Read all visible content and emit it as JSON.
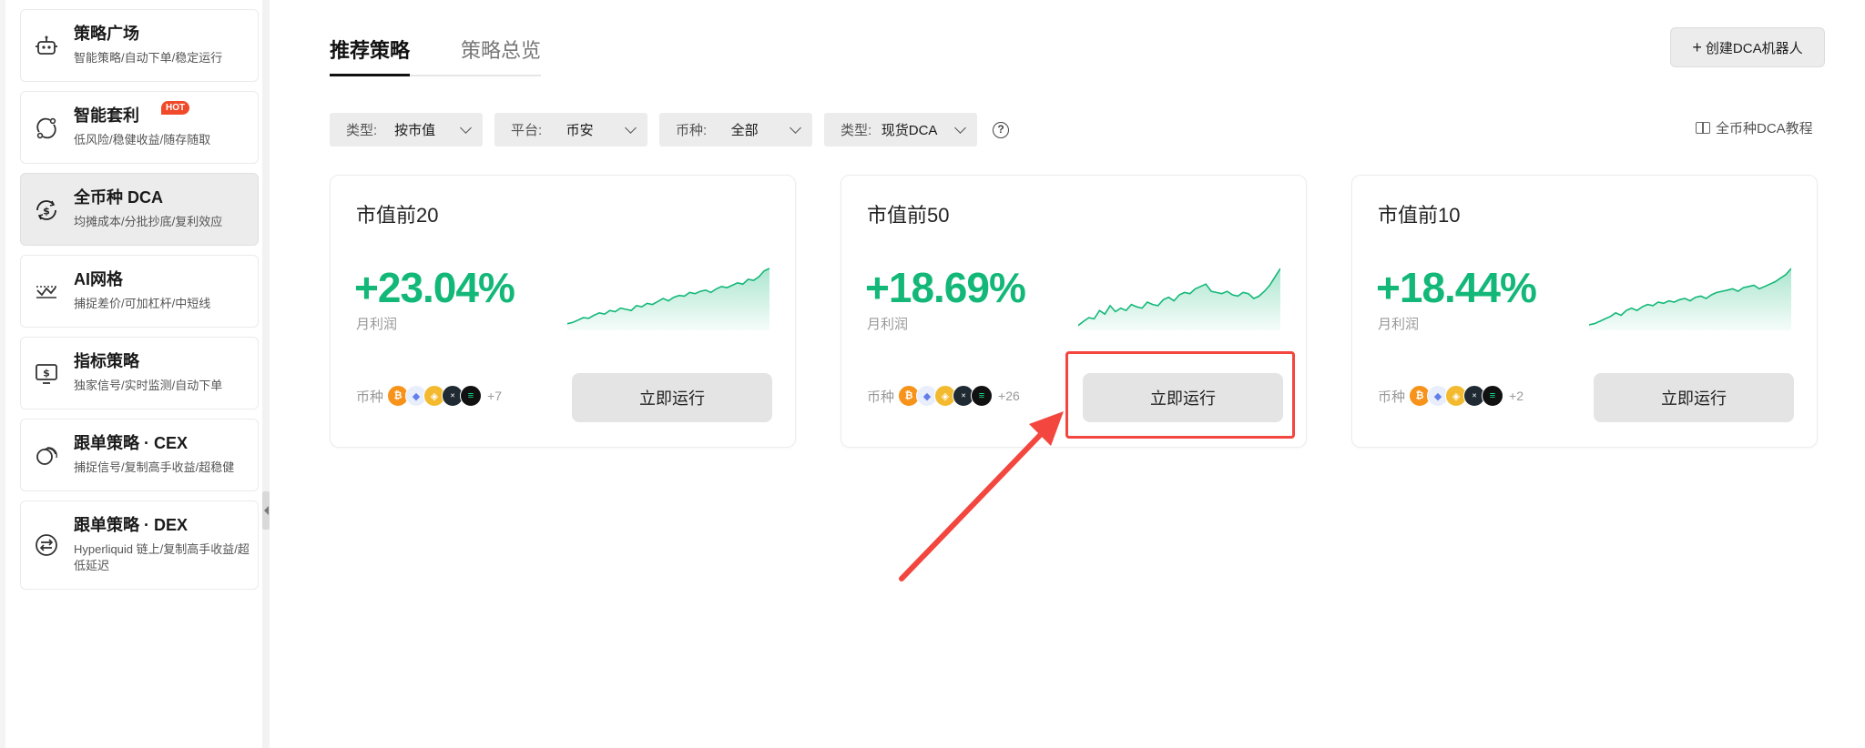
{
  "sidebar": {
    "items": [
      {
        "title": "策略广场",
        "subtitle": "智能策略/自动下单/稳定运行",
        "icon": "robot-icon"
      },
      {
        "title": "智能套利",
        "subtitle": "低风险/稳健收益/随存随取",
        "icon": "arbitrage-icon",
        "badge": "HOT"
      },
      {
        "title": "全币种 DCA",
        "subtitle": "均摊成本/分批抄底/复利效应",
        "icon": "dca-icon",
        "active": true
      },
      {
        "title": "AI网格",
        "subtitle": "捕捉差价/可加杠杆/中短线",
        "icon": "grid-icon"
      },
      {
        "title": "指标策略",
        "subtitle": "独家信号/实时监测/自动下单",
        "icon": "indicator-icon"
      },
      {
        "title": "跟单策略 · CEX",
        "subtitle": "捕捉信号/复制高手收益/超稳健",
        "icon": "copy-cex-icon"
      },
      {
        "title": "跟单策略 · DEX",
        "subtitle": "Hyperliquid 链上/复制高手收益/超低延迟",
        "icon": "copy-dex-icon"
      }
    ]
  },
  "header": {
    "tabs": [
      {
        "label": "推荐策略",
        "active": true
      },
      {
        "label": "策略总览",
        "active": false
      }
    ],
    "create_button": "创建DCA机器人"
  },
  "filters": [
    {
      "label": "类型:",
      "value": "按市值"
    },
    {
      "label": "平台:",
      "value": "币安"
    },
    {
      "label": "币种:",
      "value": "全部"
    },
    {
      "label": "类型:",
      "value": "现货DCA"
    }
  ],
  "tutorial_link": "全币种DCA教程",
  "cards": [
    {
      "title": "市值前20",
      "profit": "+23.04%",
      "profit_label": "月利润",
      "coins_label": "币种",
      "more": "+7",
      "run_label": "立即运行",
      "spark": [
        8,
        10,
        14,
        18,
        17,
        22,
        26,
        24,
        30,
        28,
        34,
        32,
        30,
        38,
        36,
        42,
        40,
        45,
        50,
        46,
        52,
        55,
        54,
        60,
        58,
        62,
        64,
        60,
        66,
        70,
        68,
        72,
        76,
        74,
        82,
        80,
        86,
        96,
        100
      ]
    },
    {
      "title": "市值前50",
      "profit": "+18.69%",
      "profit_label": "月利润",
      "coins_label": "币种",
      "more": "+26",
      "run_label": "立即运行",
      "spark": [
        5,
        12,
        18,
        16,
        30,
        24,
        38,
        28,
        34,
        30,
        40,
        36,
        34,
        44,
        40,
        38,
        48,
        52,
        46,
        56,
        60,
        58,
        66,
        70,
        74,
        62,
        60,
        58,
        62,
        56,
        54,
        60,
        58,
        50,
        54,
        62,
        72,
        86,
        100
      ]
    },
    {
      "title": "市值前10",
      "profit": "+18.44%",
      "profit_label": "月利润",
      "coins_label": "币种",
      "more": "+2",
      "run_label": "立即运行",
      "spark": [
        6,
        8,
        12,
        16,
        20,
        26,
        22,
        30,
        34,
        30,
        36,
        40,
        38,
        44,
        42,
        46,
        44,
        48,
        50,
        46,
        52,
        54,
        50,
        56,
        60,
        62,
        64,
        66,
        62,
        68,
        70,
        72,
        66,
        70,
        74,
        78,
        84,
        90,
        100
      ]
    }
  ],
  "colors": {
    "profit": "#13b878",
    "highlight": "#f2463f"
  }
}
